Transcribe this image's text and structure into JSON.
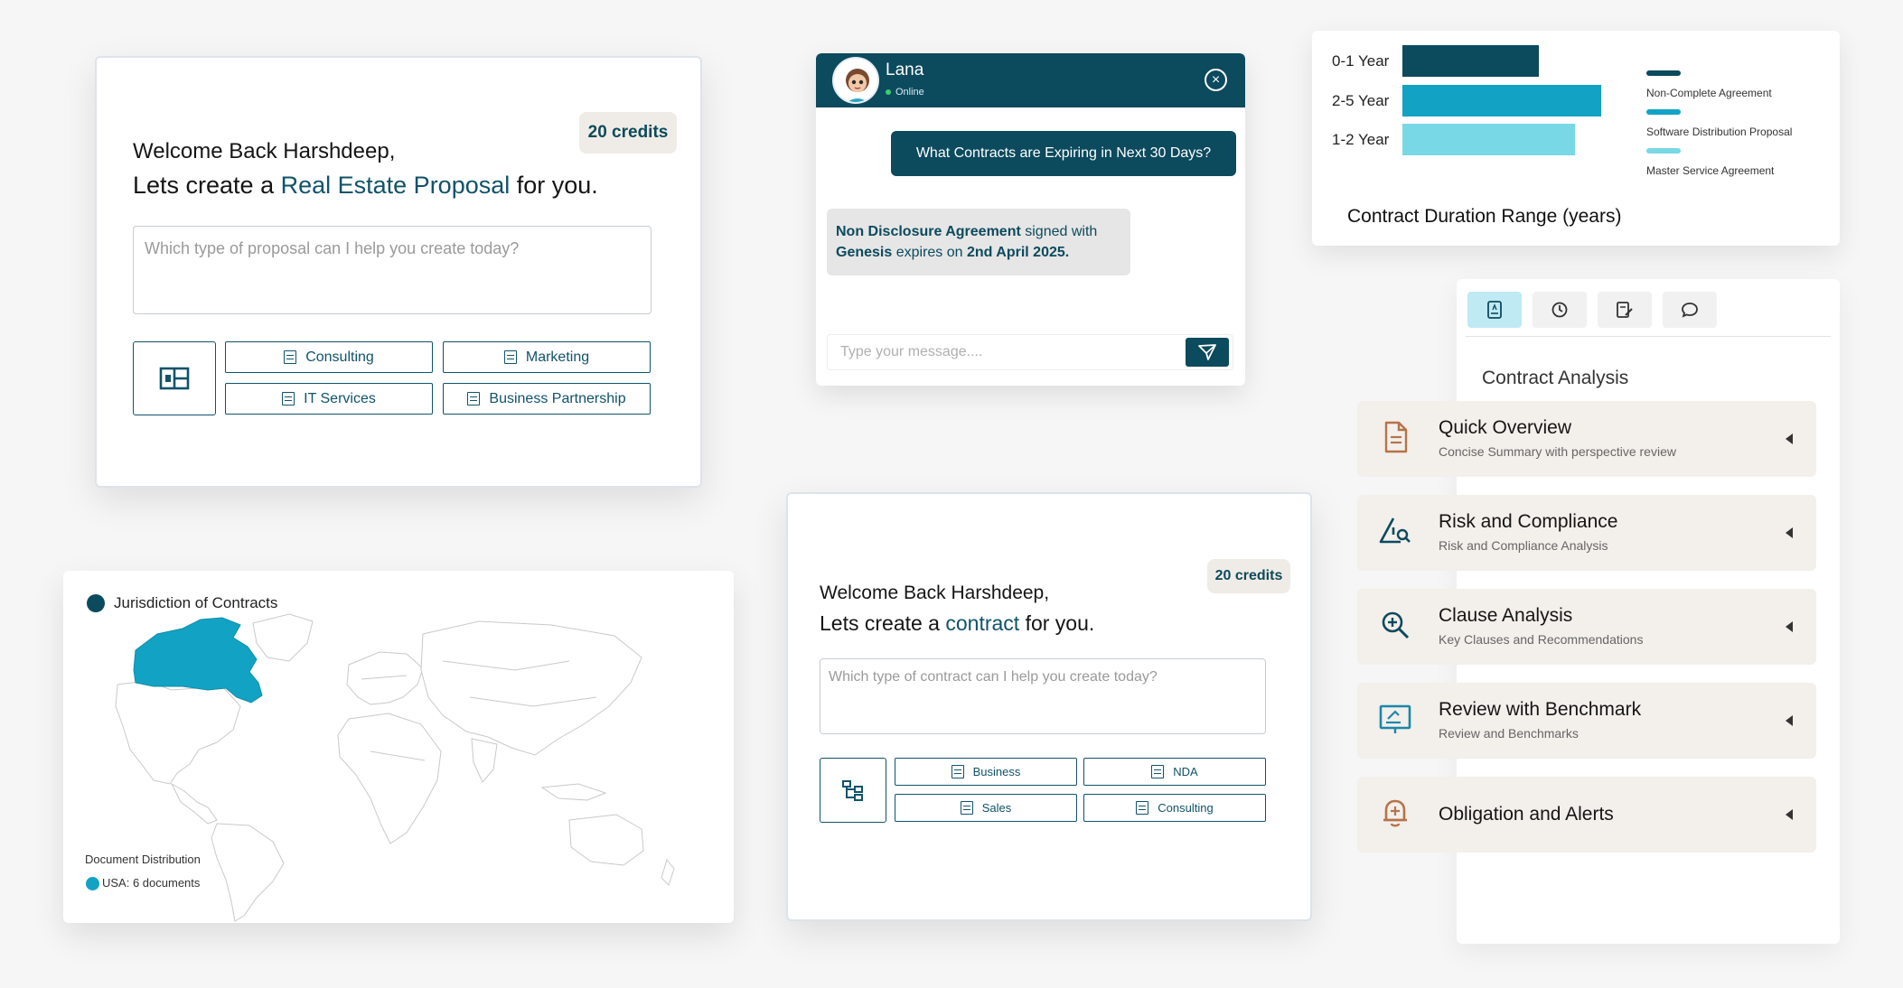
{
  "proposal_card": {
    "credits": "20 credits",
    "welcome": "Welcome Back Harshdeep,",
    "line_prefix": "Lets create a ",
    "line_accent": "Real Estate Proposal",
    "line_suffix": " for you.",
    "placeholder": "Which type of proposal can I help you create today?",
    "chips": [
      "Consulting",
      "Marketing",
      "IT Services",
      "Business Partnership"
    ]
  },
  "chat": {
    "agent_name": "Lana",
    "status": "Online",
    "user_message": "What Contracts are Expiring in Next 30 Days?",
    "bot_message": {
      "part1": "Non Disclosure Agreement",
      "part2": " signed with ",
      "part3": "Genesis",
      "part4": " expires on ",
      "part5": "2nd April 2025."
    },
    "input_placeholder": "Type your message....",
    "colors": {
      "header": "#0c4a5e",
      "online": "#38d16a"
    }
  },
  "chart_data": {
    "type": "bar",
    "orientation": "horizontal",
    "title": "Contract Duration Range (years)",
    "categories": [
      "0-1 Year",
      "2-5 Year",
      "1-2 Year"
    ],
    "values": [
      52,
      76,
      66
    ],
    "colors": [
      "#0c4a5e",
      "#12a3c4",
      "#78d8e6"
    ],
    "legend": [
      {
        "label": "Non-Complete Agreement",
        "color": "#0c4a5e"
      },
      {
        "label": "Software Distribution Proposal",
        "color": "#12a3c4"
      },
      {
        "label": "Master Service Agreement",
        "color": "#78d8e6"
      }
    ],
    "legend_position": "right",
    "grid": false
  },
  "map_card": {
    "title": "Jurisdiction of Contracts",
    "legend_heading": "Document Distribution",
    "legend_item": "USA: 6 documents",
    "highlight_color": "#12a3c4"
  },
  "contract_card": {
    "credits": "20 credits",
    "welcome": "Welcome Back Harshdeep,",
    "line_prefix": "Lets create a ",
    "line_accent": "contract",
    "line_suffix": " for you.",
    "placeholder": "Which type of contract can I help you create today?",
    "chips": [
      "Business",
      "NDA",
      "Sales",
      "Consulting"
    ]
  },
  "analysis": {
    "title": "Contract Analysis",
    "tabs": [
      "ai-document-icon",
      "history-icon",
      "edit-document-icon",
      "chat-bubble-icon"
    ],
    "items": [
      {
        "title": "Quick Overview",
        "subtitle": "Concise Summary with perspective review"
      },
      {
        "title": "Risk and Compliance",
        "subtitle": "Risk and Compliance Analysis"
      },
      {
        "title": "Clause Analysis",
        "subtitle": "Key Clauses and Recommendations"
      },
      {
        "title": "Review with Benchmark",
        "subtitle": "Review and Benchmarks"
      },
      {
        "title": "Obligation and Alerts",
        "subtitle": ""
      }
    ]
  }
}
